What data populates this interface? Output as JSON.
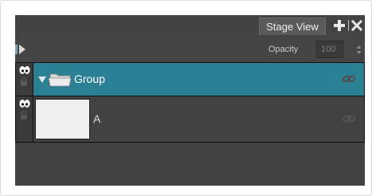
{
  "tab": {
    "label": "Stage View"
  },
  "toolbar": {
    "opacity_label": "Opacity",
    "opacity_value": "100"
  },
  "layers": [
    {
      "name": "Group",
      "type": "group",
      "selected": true
    },
    {
      "name": "A",
      "type": "drawing",
      "selected": false
    }
  ],
  "colors": {
    "panel_bg": "#434343",
    "selected_row": "#2b8094",
    "thumbnail": "#efefef"
  },
  "icons": {
    "add": "plus-icon",
    "close": "close-icon",
    "expand": "expand-panel-icon",
    "visibility": "eye-icon",
    "lock": "lock-icon",
    "folder": "folder-icon",
    "link": "link-icon"
  }
}
